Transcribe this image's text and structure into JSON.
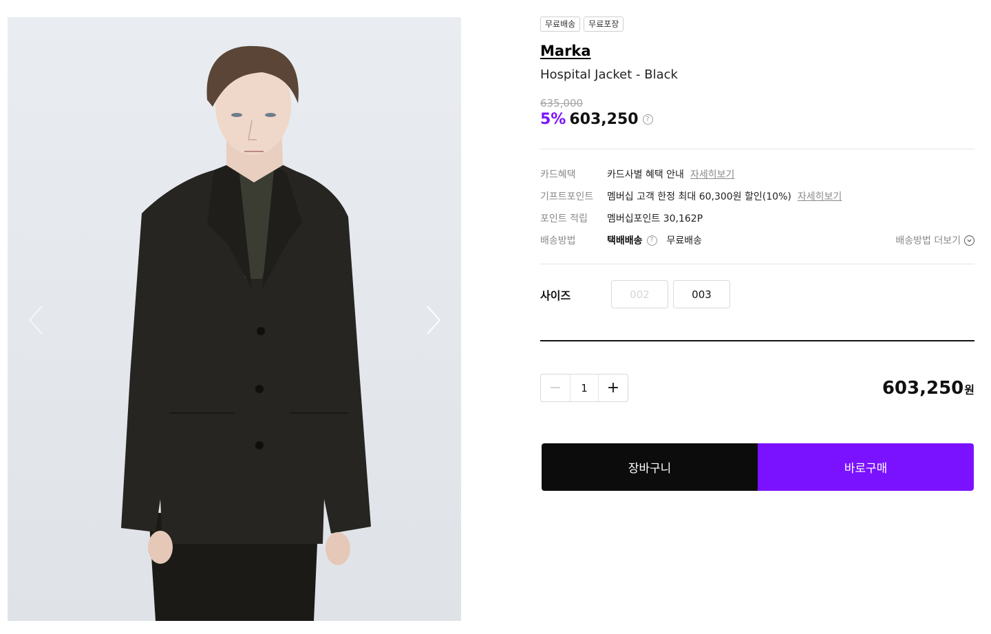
{
  "gallery": {
    "image_alt": "Hospital Jacket - Black model photo",
    "prev_icon": "chevron-left-icon",
    "next_icon": "chevron-right-icon"
  },
  "badges": [
    "무료배송",
    "무료포장"
  ],
  "product": {
    "brand": "Marka",
    "name": "Hospital Jacket - Black",
    "original_price": "635,000",
    "discount_rate": "5%",
    "final_price": "603,250",
    "price_help_icon": "question-circle-icon"
  },
  "benefits": {
    "card": {
      "label": "카드혜택",
      "value": "카드사별 혜택 안내",
      "link": "자세히보기"
    },
    "gift": {
      "label": "기프트포인트",
      "value": "멤버십 고객 한정 최대 60,300원 할인(10%)",
      "link": "자세히보기"
    },
    "points": {
      "label": "포인트 적립",
      "value": "멤버십포인트 30,162P"
    },
    "shipping": {
      "label": "배송방법",
      "method": "택배배송",
      "fee": "무료배송",
      "more": "배송방법 더보기"
    }
  },
  "size": {
    "label": "사이즈",
    "options": [
      {
        "value": "002",
        "available": false
      },
      {
        "value": "003",
        "available": true
      }
    ]
  },
  "quantity": {
    "value": "1",
    "minus": "−",
    "plus": "+"
  },
  "total": {
    "amount": "603,250",
    "unit": "원"
  },
  "actions": {
    "cart": "장바구니",
    "buy": "바로구매"
  },
  "colors": {
    "accent": "#7a12ff",
    "dark": "#0c0c0c"
  }
}
